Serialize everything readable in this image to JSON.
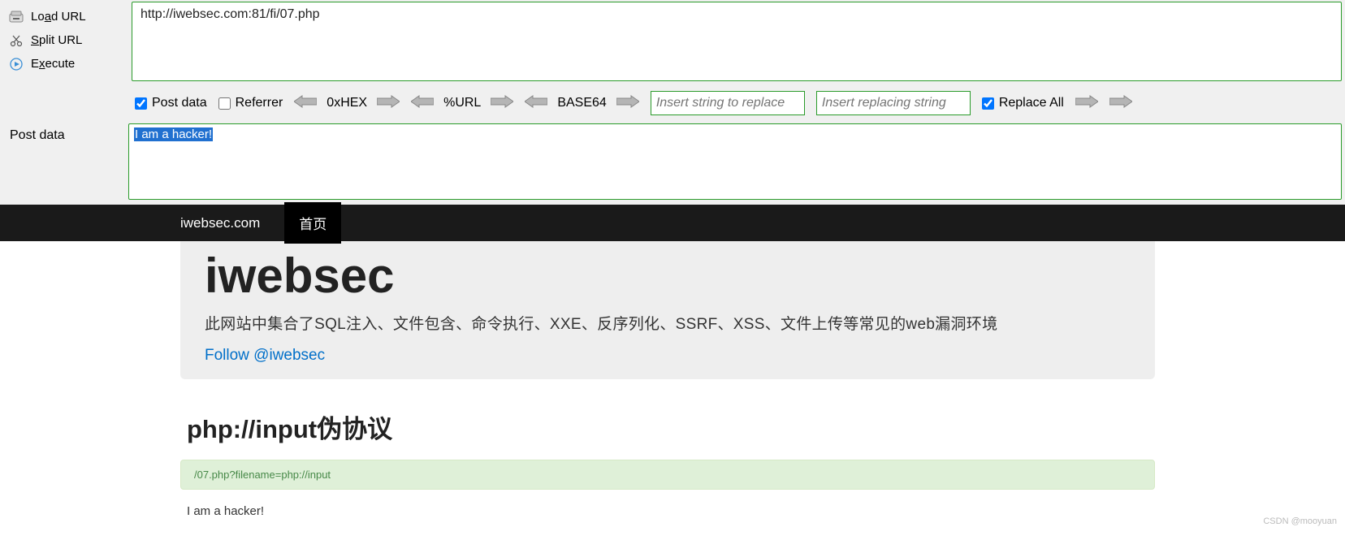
{
  "sidebar": {
    "load_url": {
      "pre": "Lo",
      "u": "a",
      "post": "d URL"
    },
    "split_url": {
      "pre": "",
      "u": "S",
      "post": "plit URL"
    },
    "execute": {
      "pre": "E",
      "u": "x",
      "post": "ecute"
    }
  },
  "url_value": "http://iwebsec.com:81/fi/07.php",
  "toolbar": {
    "post_data": "Post data",
    "referrer": "Referrer",
    "hex": "0xHEX",
    "url": "%URL",
    "base64": "BASE64",
    "replace_from_placeholder": "Insert string to replace",
    "replace_to_placeholder": "Insert replacing string",
    "replace_all": "Replace All"
  },
  "post_label": "Post data",
  "post_value": "I am a hacker!",
  "nav": {
    "brand": "iwebsec.com",
    "home": "首页"
  },
  "hero": {
    "title": "iwebsec",
    "desc": "此网站中集合了SQL注入、文件包含、命令执行、XXE、反序列化、SSRF、XSS、文件上传等常见的web漏洞环境",
    "follow": "Follow @iwebsec"
  },
  "page": {
    "heading": "php://input伪协议",
    "alert": "/07.php?filename=php://input",
    "output": "I am a hacker!"
  },
  "watermark": "CSDN @mooyuan"
}
